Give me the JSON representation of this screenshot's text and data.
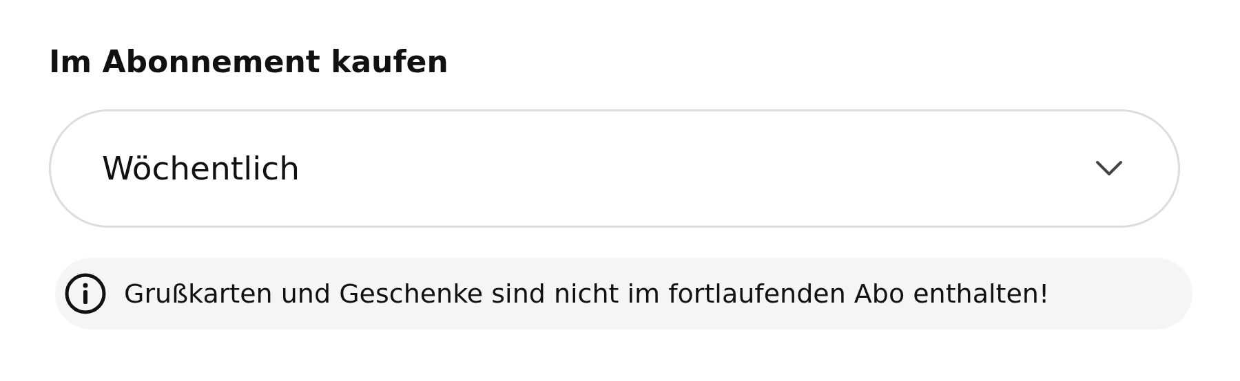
{
  "heading": "Im Abonnement kaufen",
  "select": {
    "value": "Wöchentlich"
  },
  "notice": {
    "text": "Grußkarten und Geschenke sind nicht im fortlaufenden Abo enthalten!"
  }
}
